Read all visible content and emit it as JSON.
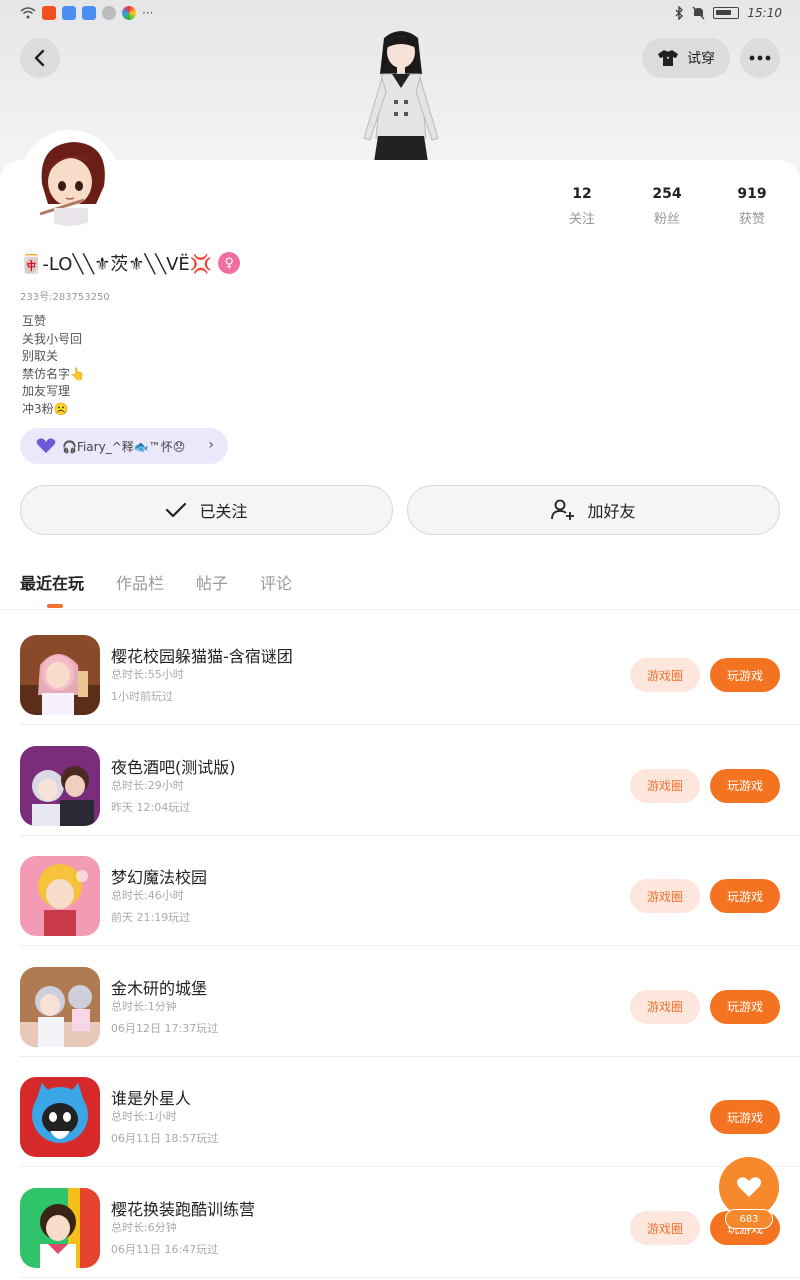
{
  "status_bar": {
    "time": "15:10",
    "left_icons": [
      "wifi-icon",
      "taobao-icon",
      "app-icon",
      "app-icon",
      "app-icon",
      "app-icon"
    ],
    "more": "···"
  },
  "header": {
    "try_on_label": "试穿"
  },
  "profile": {
    "nickname": "🀄-LO╲╲⚜茨⚜╲╲VË💢",
    "gender_symbol": "♀",
    "uid": "233号:283753250",
    "bio": [
      "互赞",
      "关我小号回",
      "别取关",
      "禁仿名字👆",
      "加友写理",
      "冲3粉☹️"
    ],
    "tag": "🎧Fiary_^释🐟™怀😞",
    "stats": [
      {
        "num": "12",
        "label": "关注"
      },
      {
        "num": "254",
        "label": "粉丝"
      },
      {
        "num": "919",
        "label": "获赞"
      }
    ]
  },
  "actions": {
    "followed_label": "已关注",
    "add_friend_label": "加好友"
  },
  "tabs": [
    {
      "label": "最近在玩",
      "active": true
    },
    {
      "label": "作品栏",
      "active": false
    },
    {
      "label": "帖子",
      "active": false
    },
    {
      "label": "评论",
      "active": false
    }
  ],
  "buttons": {
    "circle": "游戏圈",
    "play": "玩游戏"
  },
  "games": [
    {
      "title": "樱花校园躲猫猫-含宿谜团",
      "duration": "总时长:55小时",
      "last": "1小时前玩过",
      "has_circle": true
    },
    {
      "title": "夜色酒吧(测试版)",
      "duration": "总时长:29小时",
      "last": "昨天 12:04玩过",
      "has_circle": true
    },
    {
      "title": "梦幻魔法校园",
      "duration": "总时长:46小时",
      "last": "前天 21:19玩过",
      "has_circle": true
    },
    {
      "title": "金木研的城堡",
      "duration": "总时长:1分钟",
      "last": "06月12日 17:37玩过",
      "has_circle": true
    },
    {
      "title": "谁是外星人",
      "duration": "总时长:1小时",
      "last": "06月11日 18:57玩过",
      "has_circle": false
    },
    {
      "title": "樱花换装跑酷训练营",
      "duration": "总时长:6分钟",
      "last": "06月11日 16:47玩过",
      "has_circle": true
    }
  ],
  "fab": {
    "count": "683"
  },
  "colors": {
    "accent": "#f37321",
    "accent_light": "#fde7dc",
    "tag_bg": "#ebe8fb"
  }
}
